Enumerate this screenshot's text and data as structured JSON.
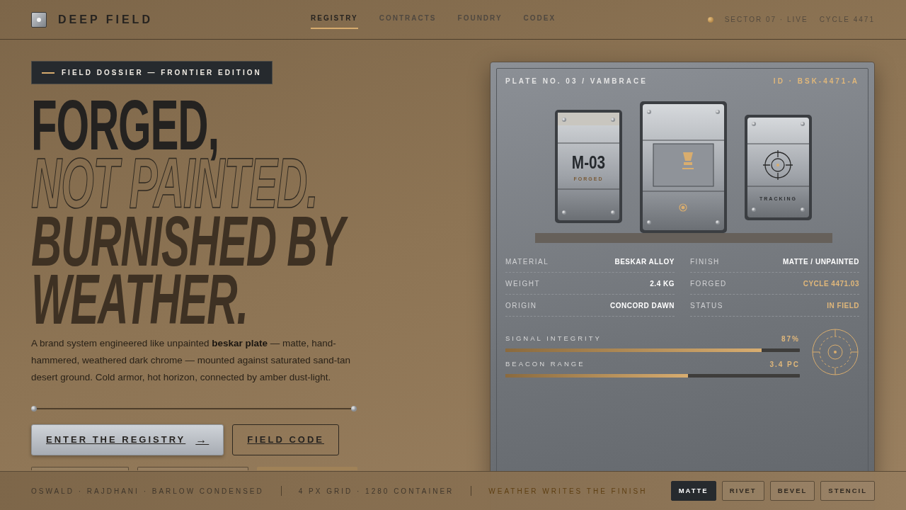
{
  "brand": {
    "name": "DEEP FIELD"
  },
  "nav": [
    {
      "label": "REGISTRY",
      "selected": true
    },
    {
      "label": "CONTRACTS",
      "selected": false
    },
    {
      "label": "FOUNDRY",
      "selected": false
    },
    {
      "label": "CODEX",
      "selected": false
    }
  ],
  "status": {
    "live": "SECTOR 07 · LIVE",
    "cycle": "CYCLE 4471"
  },
  "hero": {
    "eyebrow": "FIELD DOSSIER — FRONTIER EDITION",
    "headline": [
      {
        "text": "FORGED,",
        "kind": "solid"
      },
      {
        "text": "NOT PAINTED.",
        "kind": "outline"
      },
      {
        "text": "BURNISHED BY",
        "kind": "italic"
      },
      {
        "text": "WEATHER.",
        "kind": "italic"
      }
    ],
    "body": "A brand system engineered like unpainted **beskar plate** — matte, hand-hammered, weathered dark chrome — mounted against saturated sand-tan desert ground. Cold armor, hot horizon, connected by amber dust-light.",
    "buttons": [
      {
        "label": "ENTER THE REGISTRY",
        "kind": "primary",
        "arrow": "→"
      },
      {
        "label": "FIELD CODE",
        "kind": "outline"
      }
    ],
    "chips": [
      {
        "kind": "outline"
      },
      {
        "kind": "outline"
      },
      {
        "kind": "filled"
      }
    ]
  },
  "plate": {
    "title": "PLATE NO. 03 / VAMBRACE",
    "id": "ID · BSK-4471-A",
    "modules": [
      {
        "code": "M-03",
        "caption": "FORGED"
      },
      {
        "caption": "TRACKING"
      }
    ],
    "specs": [
      {
        "label": "MATERIAL",
        "value": "BESKAR ALLOY",
        "accent": false
      },
      {
        "label": "FINISH",
        "value": "MATTE / UNPAINTED",
        "accent": false
      },
      {
        "label": "WEIGHT",
        "value": "2.4 KG",
        "accent": false
      },
      {
        "label": "FORGED",
        "value": "CYCLE 4471.03",
        "accent": true
      },
      {
        "label": "ORIGIN",
        "value": "CONCORD DAWN",
        "accent": false
      },
      {
        "label": "STATUS",
        "value": "IN FIELD",
        "accent": true
      }
    ],
    "meters": [
      {
        "label": "SIGNAL INTEGRITY",
        "reading": "87%",
        "level": 0.87
      },
      {
        "label": "BEACON RANGE",
        "reading": "3.4 PC",
        "level": 0.62
      }
    ]
  },
  "footer": {
    "notes": [
      {
        "text": "OSWALD · RAJDHANI · BARLOW CONDENSED",
        "kind": "muted"
      },
      {
        "text": "4 PX GRID · 1280 CONTAINER",
        "kind": "muted"
      },
      {
        "text": "WEATHER WRITES THE FINISH",
        "kind": "amber"
      }
    ],
    "finishes": [
      {
        "label": "MATTE",
        "selected": true
      },
      {
        "label": "RIVET",
        "selected": false
      },
      {
        "label": "BEVEL",
        "selected": false
      },
      {
        "label": "STENCIL",
        "selected": false
      }
    ]
  }
}
